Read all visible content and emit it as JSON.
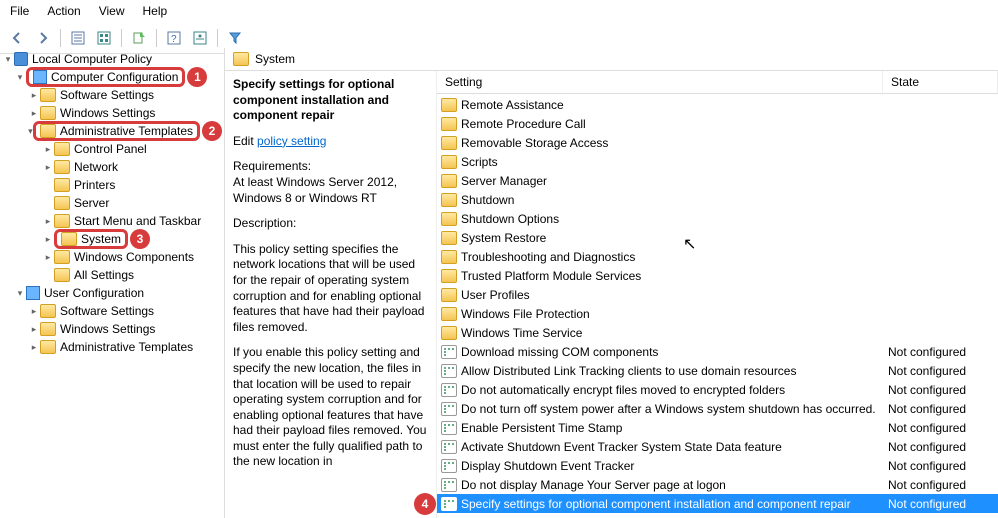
{
  "menu": {
    "file": "File",
    "action": "Action",
    "view": "View",
    "help": "Help"
  },
  "breadcrumb": "System",
  "tree": {
    "root": "Local Computer Policy",
    "cc": "Computer Configuration",
    "ss": "Software Settings",
    "ws": "Windows Settings",
    "at": "Administrative Templates",
    "cp": "Control Panel",
    "net": "Network",
    "prn": "Printers",
    "srv": "Server",
    "smtb": "Start Menu and Taskbar",
    "sys": "System",
    "wc": "Windows Components",
    "as": "All Settings",
    "uc": "User Configuration",
    "uss": "Software Settings",
    "uws": "Windows Settings",
    "uat": "Administrative Templates"
  },
  "info": {
    "title": "Specify settings for optional component installation and component repair",
    "edit": "Edit",
    "link": "policy setting ",
    "req_label": "Requirements:",
    "req": "At least Windows Server 2012, Windows 8 or Windows RT",
    "desc_label": "Description:",
    "desc1": "This policy setting specifies the network locations that will be used for the repair of operating system corruption and for enabling optional features that have had their payload files removed.",
    "desc2": "If you enable this policy setting and specify the new location, the files in that location will be used to repair operating system corruption and for enabling optional features that have had their payload files removed. You must enter the fully qualified path to the new location in"
  },
  "cols": {
    "setting": "Setting",
    "state": "State"
  },
  "state_nc": "Not configured",
  "folders": [
    "Remote Assistance",
    "Remote Procedure Call",
    "Removable Storage Access",
    "Scripts",
    "Server Manager",
    "Shutdown",
    "Shutdown Options",
    "System Restore",
    "Troubleshooting and Diagnostics",
    "Trusted Platform Module Services",
    "User Profiles",
    "Windows File Protection",
    "Windows Time Service"
  ],
  "settings": [
    "Download missing COM components",
    "Allow Distributed Link Tracking clients to use domain resources",
    "Do not automatically encrypt files moved to encrypted folders",
    "Do not turn off system power after a Windows system shutdown has occurred.",
    "Enable Persistent Time Stamp",
    "Activate Shutdown Event Tracker System State Data feature",
    "Display Shutdown Event Tracker",
    "Do not display Manage Your Server page at logon",
    "Specify settings for optional component installation and component repair"
  ],
  "callouts": {
    "c1": "1",
    "c2": "2",
    "c3": "3",
    "c4": "4"
  }
}
